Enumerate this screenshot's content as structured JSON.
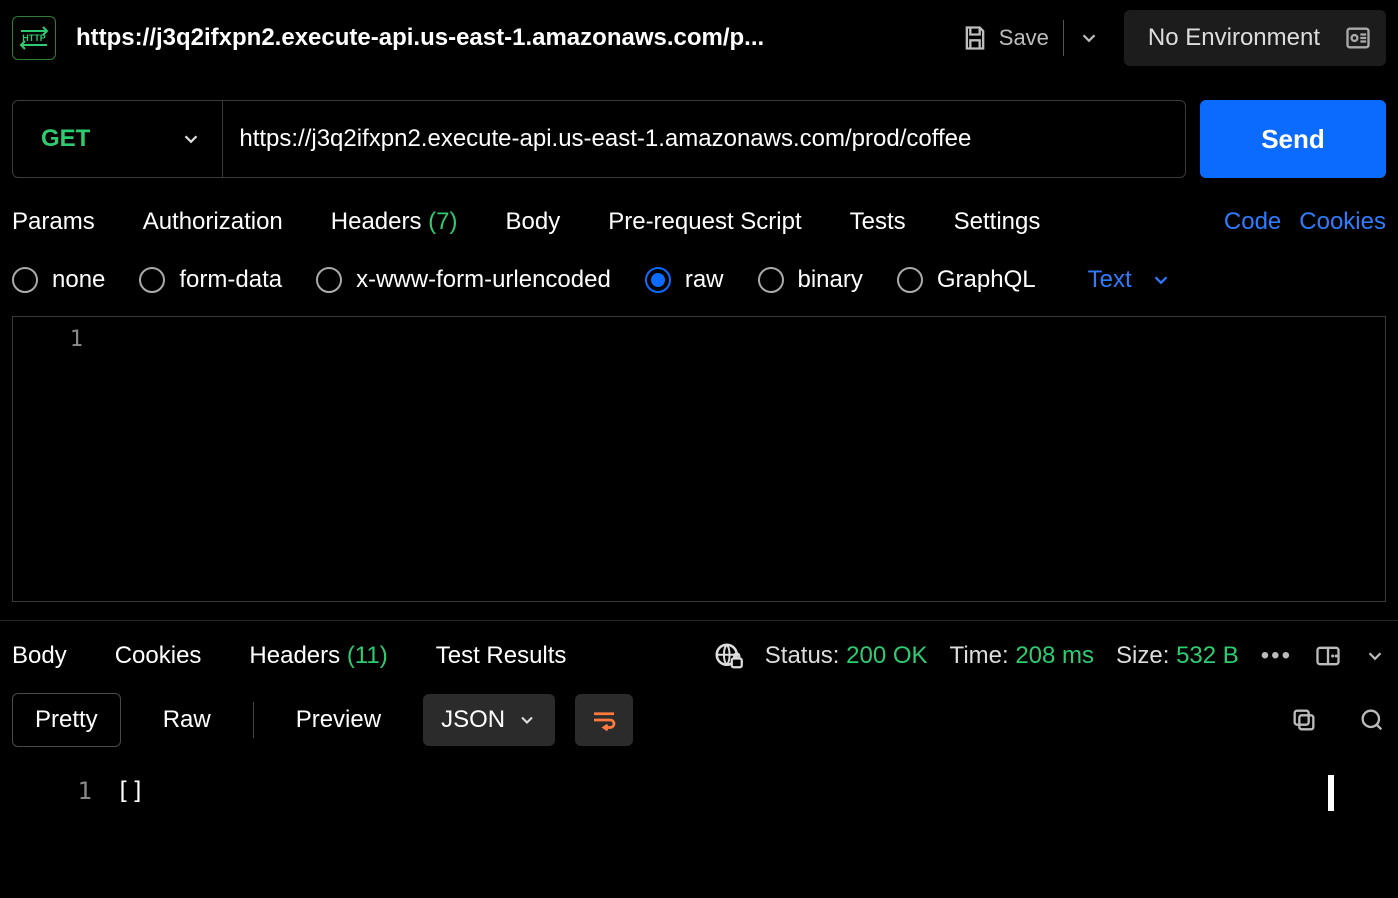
{
  "topbar": {
    "http_badge_text": "HTTP",
    "tab_title": "https://j3q2ifxpn2.execute-api.us-east-1.amazonaws.com/p...",
    "save_label": "Save",
    "environment_label": "No Environment"
  },
  "request": {
    "method": "GET",
    "url": "https://j3q2ifxpn2.execute-api.us-east-1.amazonaws.com/prod/coffee",
    "send_label": "Send"
  },
  "request_tabs": {
    "params": "Params",
    "authorization": "Authorization",
    "headers_label": "Headers",
    "headers_count": "(7)",
    "body": "Body",
    "prerequest": "Pre-request Script",
    "tests": "Tests",
    "settings": "Settings",
    "code_link": "Code",
    "cookies_link": "Cookies"
  },
  "body_options": {
    "none": "none",
    "form_data": "form-data",
    "urlencoded": "x-www-form-urlencoded",
    "raw": "raw",
    "binary": "binary",
    "graphql": "GraphQL",
    "selected": "raw",
    "content_type": "Text"
  },
  "request_editor": {
    "line1_number": "1",
    "line1_text": ""
  },
  "response_tabs": {
    "body": "Body",
    "cookies": "Cookies",
    "headers_label": "Headers",
    "headers_count": "(11)",
    "test_results": "Test Results"
  },
  "response_status": {
    "status_label": "Status:",
    "status_value": "200 OK",
    "time_label": "Time:",
    "time_value": "208 ms",
    "size_label": "Size:",
    "size_value": "532 B"
  },
  "response_toolbar": {
    "pretty": "Pretty",
    "raw": "Raw",
    "preview": "Preview",
    "format": "JSON"
  },
  "response_editor": {
    "line1_number": "1",
    "line1_text": "[]"
  }
}
